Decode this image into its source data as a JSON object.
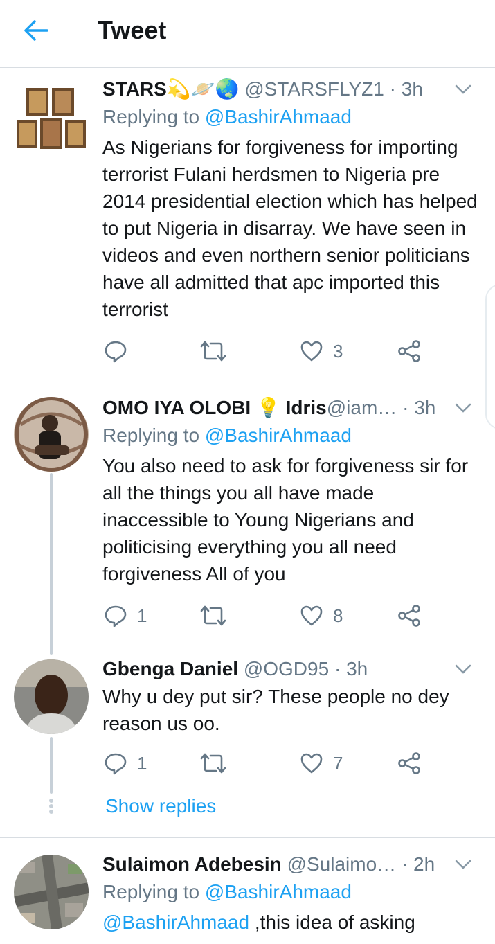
{
  "header": {
    "title": "Tweet"
  },
  "tweets": [
    {
      "name": "STARS",
      "name_emoji": "💫🪐🌏",
      "handle": "@STARSFLYZ1",
      "time": "3h",
      "replying_prefix": "Replying to",
      "replying_to": "@BashirAhmaad",
      "text": "As Nigerians for forgiveness for importing terrorist Fulani herdsmen to Nigeria pre 2014 presidential election which has helped to put Nigeria in disarray. We have seen in videos and even northern senior politicians have all admitted that apc imported this terrorist",
      "replies": "",
      "retweets": "",
      "likes": "3"
    },
    {
      "name": "OMO IYA OLOBI",
      "name_emoji": "💡",
      "name_suffix": "Idris",
      "handle": "@iam…",
      "time": "3h",
      "replying_prefix": "Replying to",
      "replying_to": "@BashirAhmaad",
      "text": "You also need to ask for forgiveness sir for all the things you all have made inaccessible to Young Nigerians and politicising everything you all need forgiveness All of you",
      "replies": "1",
      "retweets": "",
      "likes": "8"
    },
    {
      "name": "Gbenga Daniel",
      "handle": "@OGD95",
      "time": "3h",
      "text": "Why u dey put sir? These people no dey reason us oo.",
      "replies": "1",
      "retweets": "",
      "likes": "7"
    },
    {
      "name": "Sulaimon Adebesin",
      "handle": "@Sulaimo…",
      "time": "2h",
      "replying_prefix": "Replying to",
      "replying_to": "@BashirAhmaad",
      "text_mention": "@BashirAhmaad",
      "text": " ,this idea of asking"
    }
  ],
  "show_replies": "Show replies",
  "dot_separator": "·",
  "colors": {
    "accent": "#1da1f2",
    "muted": "#657786",
    "text": "#14171a",
    "divider": "#d8dde2"
  }
}
